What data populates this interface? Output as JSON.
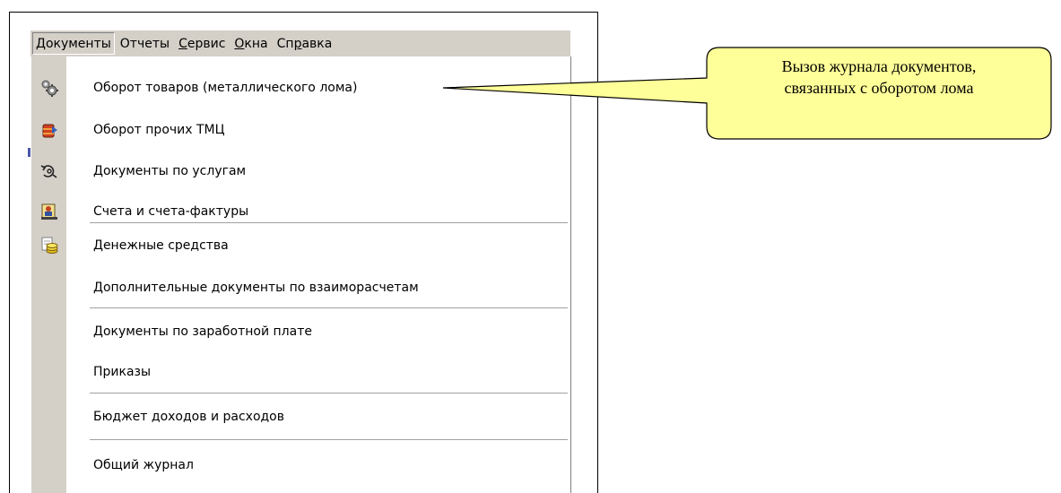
{
  "menubar": {
    "items": [
      {
        "label": "Документы",
        "accel": "",
        "active": true
      },
      {
        "label": "Отчеты",
        "accel": "",
        "active": false
      },
      {
        "label": "Сервис",
        "accel": "С",
        "active": false
      },
      {
        "label": "Окна",
        "accel": "О",
        "active": false
      },
      {
        "label": "Справка",
        "accel": "р",
        "active": false
      }
    ]
  },
  "menu": {
    "items": [
      {
        "label": "Оборот товаров (металлического лома)",
        "icon": "gears-icon"
      },
      {
        "label": "Оборот прочих ТМЦ",
        "icon": "barrel-icon"
      },
      {
        "label": "Документы по услугам",
        "icon": "service-arrows-icon"
      },
      {
        "label": "Счета и счета-фактуры",
        "icon": "invoice-person-icon"
      },
      {
        "label": "Денежные средства",
        "icon": "coins-document-icon"
      },
      {
        "label": "Дополнительные документы по взаиморасчетам",
        "icon": ""
      },
      {
        "label": "Документы по заработной плате",
        "icon": ""
      },
      {
        "label": "Приказы",
        "icon": ""
      },
      {
        "label": "Бюджет доходов и расходов",
        "icon": ""
      },
      {
        "label": "Общий журнал",
        "icon": ""
      }
    ]
  },
  "callout": {
    "line1": "Вызов журнала документов,",
    "line2": "связанных с оборотом лома"
  },
  "colors": {
    "menu_bg": "#d4d0c8",
    "callout_fill": "#ffff99"
  }
}
